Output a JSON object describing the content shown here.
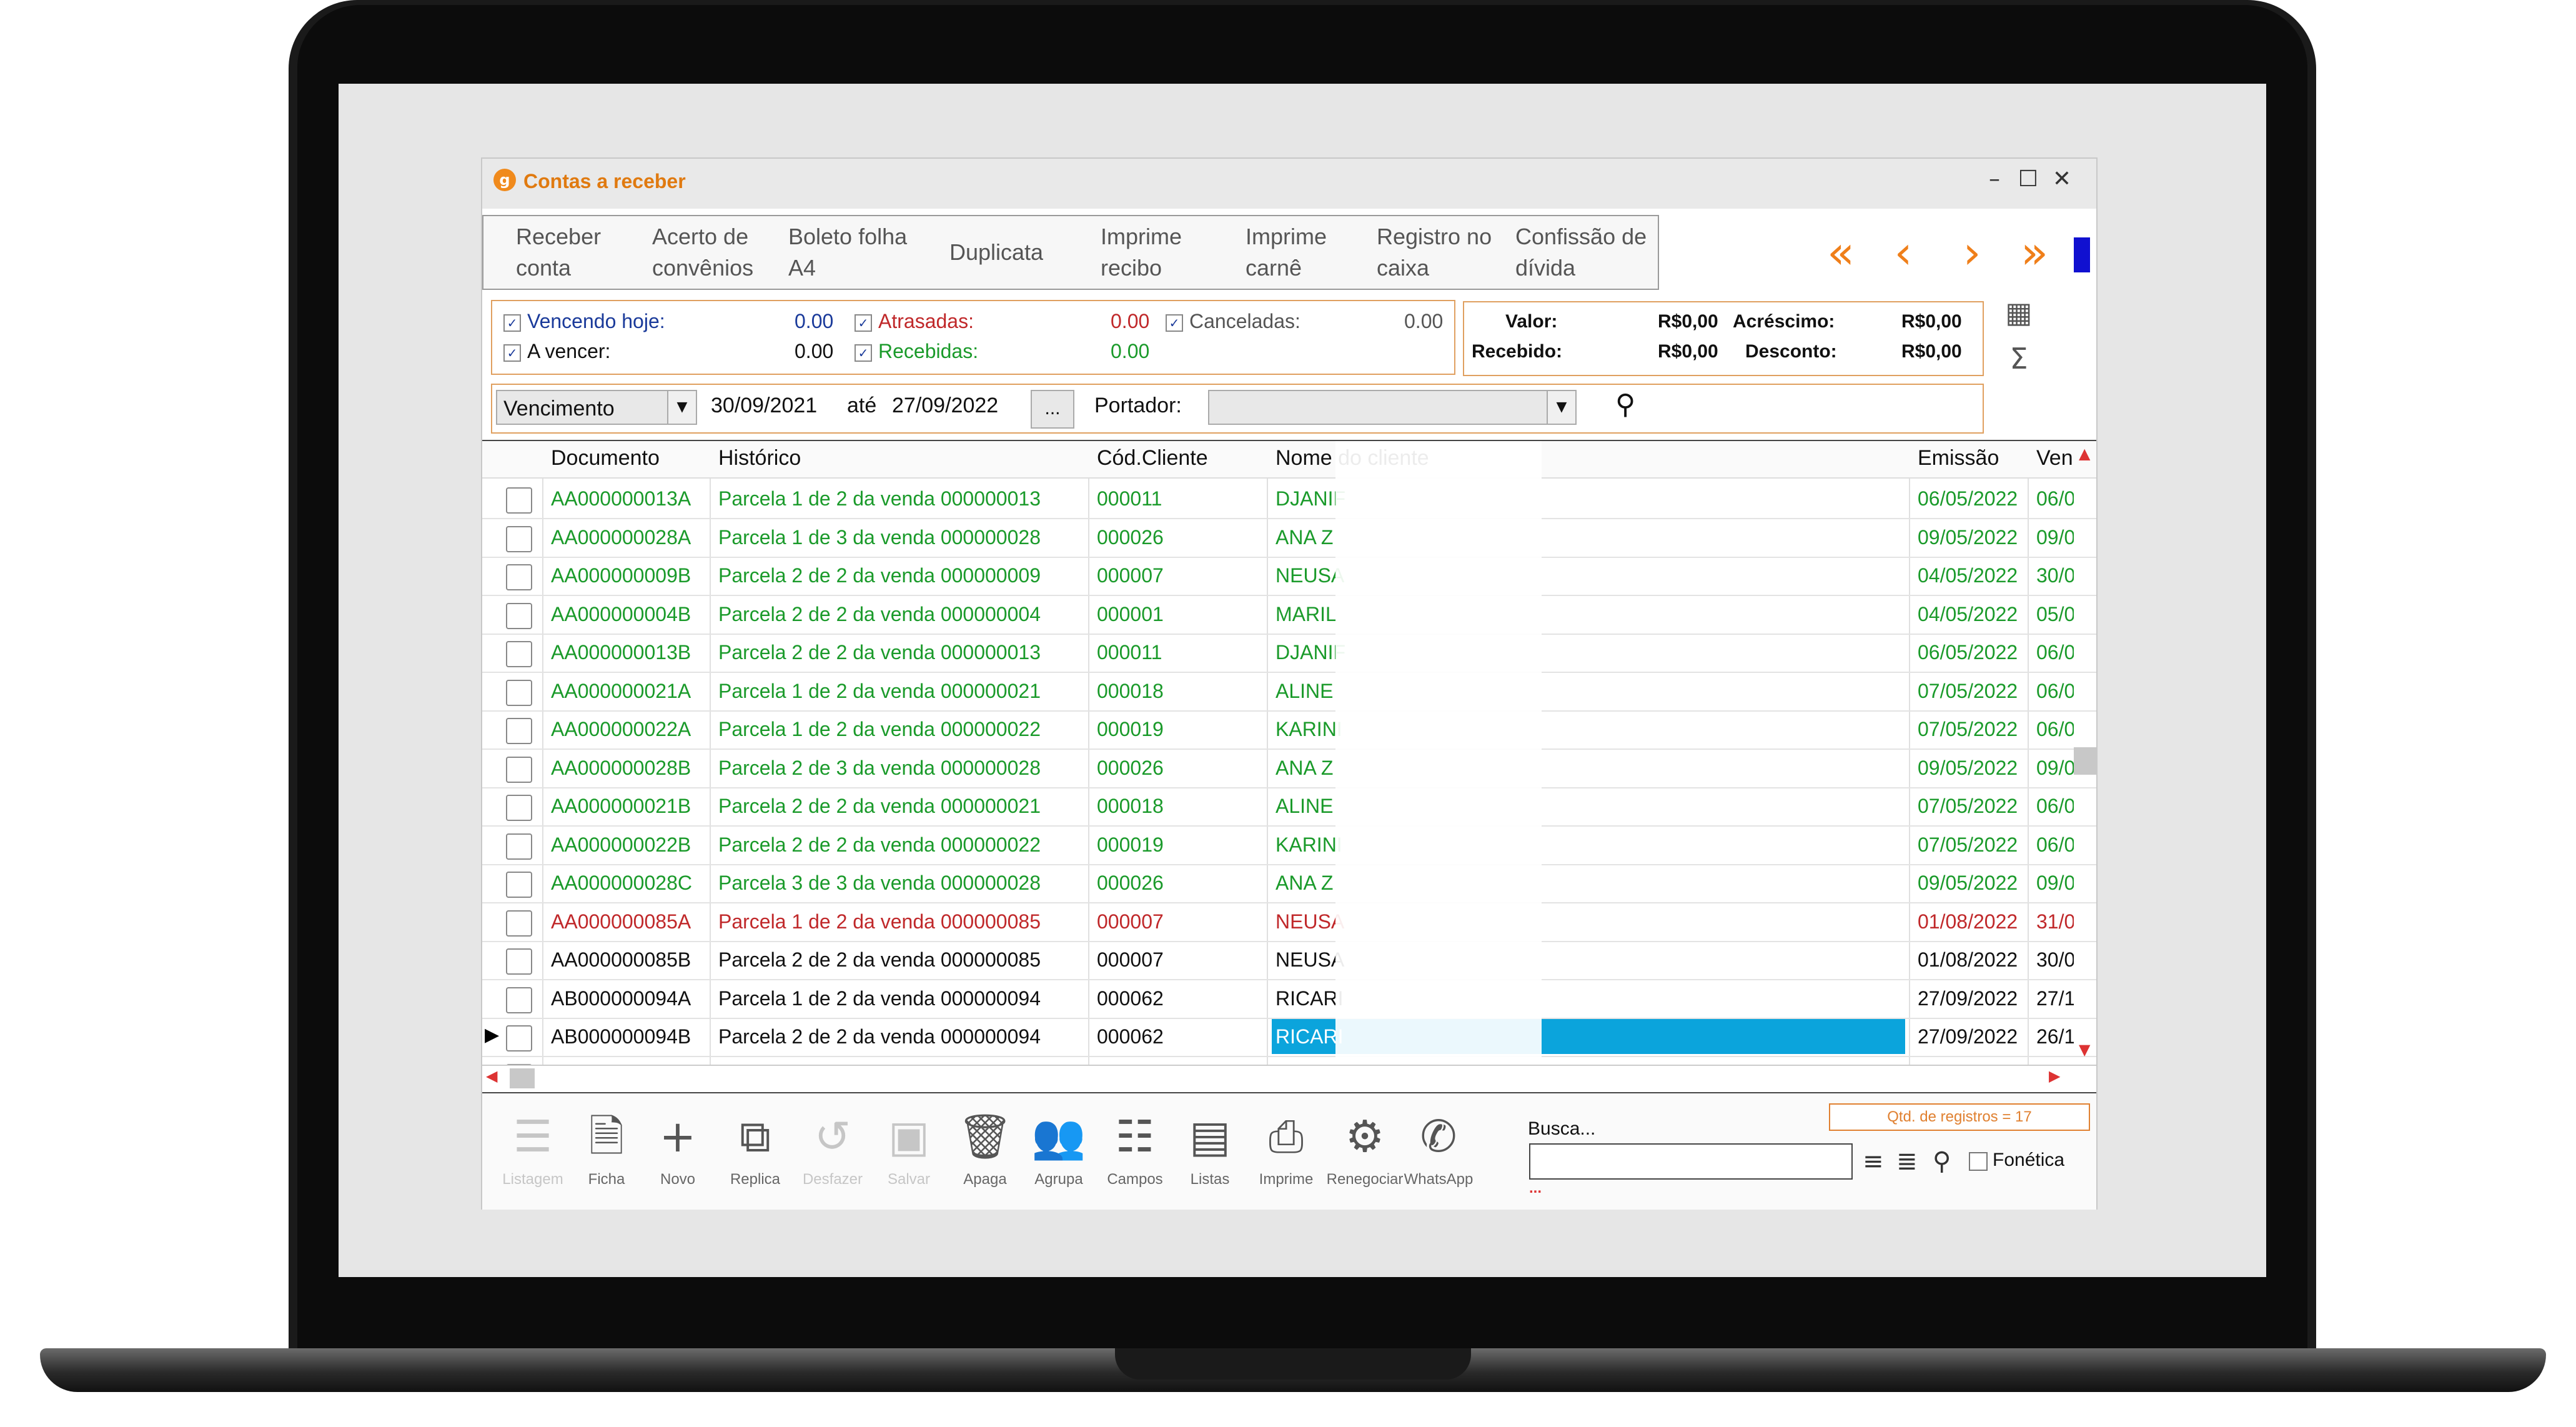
{
  "window": {
    "title": "Contas a receber",
    "app_icon": "g",
    "minimize": "–",
    "maximize": "☐",
    "close": "✕"
  },
  "toolbar": {
    "buttons": [
      "Receber\nconta",
      "Acerto de\nconvênios",
      "Boleto folha\nA4",
      "Duplicata",
      "Imprime\nrecibo",
      "Imprime\ncarnê",
      "Registro no\ncaixa",
      "Confissão de\ndívida"
    ],
    "nav": [
      "«",
      "‹",
      "›",
      "»"
    ]
  },
  "filters": {
    "vencendo_hoje": {
      "label": "Vencendo hoje:",
      "value": "0.00",
      "checked": "✓"
    },
    "a_vencer": {
      "label": "A vencer:",
      "value": "0.00",
      "checked": "✓"
    },
    "atrasadas": {
      "label": "Atrasadas:",
      "value": "0.00",
      "checked": "✓"
    },
    "recebidas": {
      "label": "Recebidas:",
      "value": "0.00",
      "checked": "✓"
    },
    "canceladas": {
      "label": "Canceladas:",
      "value": "0.00",
      "checked": "✓"
    }
  },
  "totals": {
    "valor_label": "Valor:",
    "valor": "R$0,00",
    "acrescimo_label": "Acréscimo:",
    "acrescimo": "R$0,00",
    "recebido_label": "Recebido:",
    "recebido": "R$0,00",
    "desconto_label": "Desconto:",
    "desconto": "R$0,00"
  },
  "side_icons": {
    "calendar": "▦",
    "sum": "Σ"
  },
  "date_filter": {
    "field": "Vencimento",
    "from": "30/09/2021",
    "ate": "até",
    "to": "27/09/2022",
    "ellipsis": "...",
    "portador_label": "Portador:",
    "portador": "",
    "filter_icon": "⚲",
    "arrow": "▼"
  },
  "table": {
    "headers": [
      "Documento",
      "Histórico",
      "Cód.Cliente",
      "Nome do cliente",
      "Emissão",
      "Ven"
    ],
    "rows": [
      {
        "doc": "AA000000013A",
        "hist": "Parcela 1 de 2 da venda 000000013",
        "cod": "000011",
        "nome": "DJANIF",
        "emissao": "06/05/2022",
        "ven": "06/0",
        "color": "#1a9a2a"
      },
      {
        "doc": "AA000000028A",
        "hist": "Parcela 1 de 3 da venda 000000028",
        "cod": "000026",
        "nome": "ANA Z",
        "emissao": "09/05/2022",
        "ven": "09/0",
        "color": "#1a9a2a"
      },
      {
        "doc": "AA000000009B",
        "hist": "Parcela 2 de 2 da venda 000000009",
        "cod": "000007",
        "nome": "NEUSA",
        "emissao": "04/05/2022",
        "ven": "30/0",
        "color": "#1a9a2a"
      },
      {
        "doc": "AA000000004B",
        "hist": "Parcela 2 de 2 da venda 000000004",
        "cod": "000001",
        "nome": "MARIL",
        "emissao": "04/05/2022",
        "ven": "05/0",
        "color": "#1a9a2a"
      },
      {
        "doc": "AA000000013B",
        "hist": "Parcela 2 de 2 da venda 000000013",
        "cod": "000011",
        "nome": "DJANIF",
        "emissao": "06/05/2022",
        "ven": "06/0",
        "color": "#1a9a2a"
      },
      {
        "doc": "AA000000021A",
        "hist": "Parcela 1 de 2 da venda 000000021",
        "cod": "000018",
        "nome": "ALINE",
        "emissao": "07/05/2022",
        "ven": "06/0",
        "color": "#1a9a2a"
      },
      {
        "doc": "AA000000022A",
        "hist": "Parcela 1 de 2 da venda 000000022",
        "cod": "000019",
        "nome": "KARINI",
        "emissao": "07/05/2022",
        "ven": "06/0",
        "color": "#1a9a2a"
      },
      {
        "doc": "AA000000028B",
        "hist": "Parcela 2 de 3 da venda 000000028",
        "cod": "000026",
        "nome": "ANA Z",
        "emissao": "09/05/2022",
        "ven": "09/0",
        "color": "#1a9a2a"
      },
      {
        "doc": "AA000000021B",
        "hist": "Parcela 2 de 2 da venda 000000021",
        "cod": "000018",
        "nome": "ALINE",
        "emissao": "07/05/2022",
        "ven": "06/0",
        "color": "#1a9a2a"
      },
      {
        "doc": "AA000000022B",
        "hist": "Parcela 2 de 2 da venda 000000022",
        "cod": "000019",
        "nome": "KARINI",
        "emissao": "07/05/2022",
        "ven": "06/0",
        "color": "#1a9a2a"
      },
      {
        "doc": "AA000000028C",
        "hist": "Parcela 3 de 3 da venda 000000028",
        "cod": "000026",
        "nome": "ANA Z",
        "emissao": "09/05/2022",
        "ven": "09/0",
        "color": "#1a9a2a"
      },
      {
        "doc": "AA000000085A",
        "hist": "Parcela 1 de 2 da venda 000000085",
        "cod": "000007",
        "nome": "NEUSA",
        "emissao": "01/08/2022",
        "ven": "31/0",
        "color": "#c0282a"
      },
      {
        "doc": "AA000000085B",
        "hist": "Parcela 2 de 2 da venda 000000085",
        "cod": "000007",
        "nome": "NEUSA",
        "emissao": "01/08/2022",
        "ven": "30/0",
        "color": "#111111"
      },
      {
        "doc": "AB000000094A",
        "hist": "Parcela 1 de 2 da venda 000000094",
        "cod": "000062",
        "nome": "RICARI",
        "emissao": "27/09/2022",
        "ven": "27/1",
        "color": "#111111"
      },
      {
        "doc": "AB000000094B",
        "hist": "Parcela 2 de 2 da venda 000000094",
        "cod": "000062",
        "nome": "RICARI",
        "emissao": "27/09/2022",
        "ven": "26/1",
        "color": "#111111"
      }
    ],
    "selected_color": "#0ba4dc",
    "row_pointer": "▶"
  },
  "bottom": {
    "buttons": [
      {
        "label": "Listagem",
        "icon": "☰",
        "icon_name": "list-icon",
        "disabled": true
      },
      {
        "label": "Ficha",
        "icon": "🗎",
        "icon_name": "document-icon",
        "disabled": false
      },
      {
        "label": "Novo",
        "icon": "+",
        "icon_name": "plus-icon",
        "disabled": false
      },
      {
        "label": "Replica",
        "icon": "⧉",
        "icon_name": "copy-icon",
        "disabled": false
      },
      {
        "label": "Desfazer",
        "icon": "↺",
        "icon_name": "undo-icon",
        "disabled": true
      },
      {
        "label": "Salvar",
        "icon": "▣",
        "icon_name": "save-icon",
        "disabled": true
      },
      {
        "label": "Apaga",
        "icon": "🗑",
        "icon_name": "trash-icon",
        "disabled": false
      },
      {
        "label": "Agrupa",
        "icon": "👥",
        "icon_name": "group-icon",
        "disabled": false
      },
      {
        "label": "Campos",
        "icon": "☷",
        "icon_name": "fields-icon",
        "disabled": false
      },
      {
        "label": "Listas",
        "icon": "▤",
        "icon_name": "lists-icon",
        "disabled": false
      },
      {
        "label": "Imprime",
        "icon": "⎙",
        "icon_name": "printer-icon",
        "disabled": false
      },
      {
        "label": "Renegociar",
        "icon": "⚙",
        "icon_name": "renegotiate-icon",
        "disabled": false
      },
      {
        "label": "WhatsApp",
        "icon": "✆",
        "icon_name": "whatsapp-icon",
        "disabled": false
      }
    ],
    "busca_label": "Busca...",
    "busca_value": "",
    "qtd": "Qtd. de registros = 17",
    "dots": "...",
    "align_left": "≡",
    "align_center": "≣",
    "filter": "⚲",
    "fonetica": "Fonética"
  }
}
